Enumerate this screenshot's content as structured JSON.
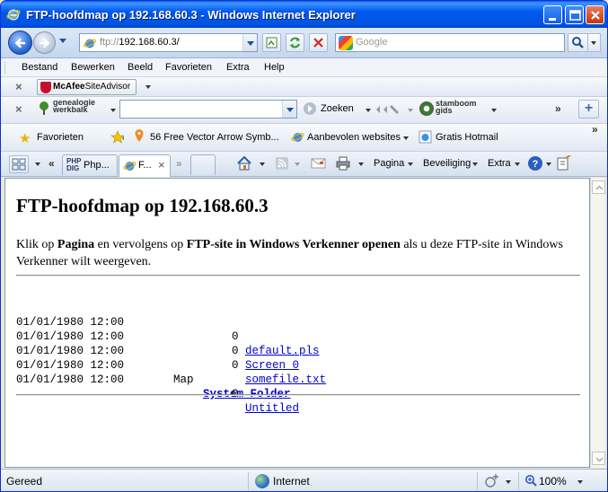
{
  "window": {
    "title": "FTP-hoofdmap op 192.168.60.3 - Windows Internet Explorer"
  },
  "address": {
    "protocol": "ftp://",
    "host": "192.168.60.3/"
  },
  "search": {
    "placeholder": "Google"
  },
  "menu": [
    "Bestand",
    "Bewerken",
    "Beeld",
    "Favorieten",
    "Extra",
    "Help"
  ],
  "toolbars": {
    "mcafee": {
      "brand": "McAfee",
      "product": "SiteAdvisor"
    },
    "genealogie": {
      "line1": "genealogie",
      "line2": "werkbalk"
    },
    "zoeken_label": "Zoeken",
    "stamboom": {
      "line1": "stamboom",
      "line2": "gids"
    },
    "overflow": "»"
  },
  "favorites_bar": {
    "favorites_label": "Favorieten",
    "items": [
      "56 Free Vector Arrow Symb...",
      "Aanbevolen websites",
      "Gratis Hotmail"
    ]
  },
  "tabs": {
    "nav_left": "«",
    "items": [
      "Php...",
      "F..."
    ],
    "overflow": "»"
  },
  "commands": {
    "pagina": "Pagina",
    "beveiliging": "Beveiliging",
    "extra": "Extra"
  },
  "page": {
    "heading": "FTP-hoofdmap op 192.168.60.3",
    "intro_part1": "Klik op ",
    "intro_bold1": "Pagina",
    "intro_part2": " en vervolgens op ",
    "intro_bold2": "FTP-site in Windows Verkenner openen",
    "intro_part3": " als u deze FTP-site in Windows Verkenner wilt weergeven.",
    "entries": [
      {
        "date": "01/01/1980 12:00",
        "size": "0",
        "type": "",
        "name": "default.pls"
      },
      {
        "date": "01/01/1980 12:00",
        "size": "0",
        "type": "",
        "name": "Screen 0"
      },
      {
        "date": "01/01/1980 12:00",
        "size": "0",
        "type": "",
        "name": "somefile.txt"
      },
      {
        "date": "01/01/1980 12:00",
        "size": "",
        "type": "Map",
        "name": "System Folder"
      },
      {
        "date": "01/01/1980 12:00",
        "size": "0",
        "type": "",
        "name": "Untitled"
      }
    ]
  },
  "status": {
    "text": "Gereed",
    "zone": "Internet",
    "zoom": "100%"
  },
  "colors": {
    "titlebar": "#0054e3",
    "link": "#0000cc",
    "chrome": "#dce8f6"
  }
}
